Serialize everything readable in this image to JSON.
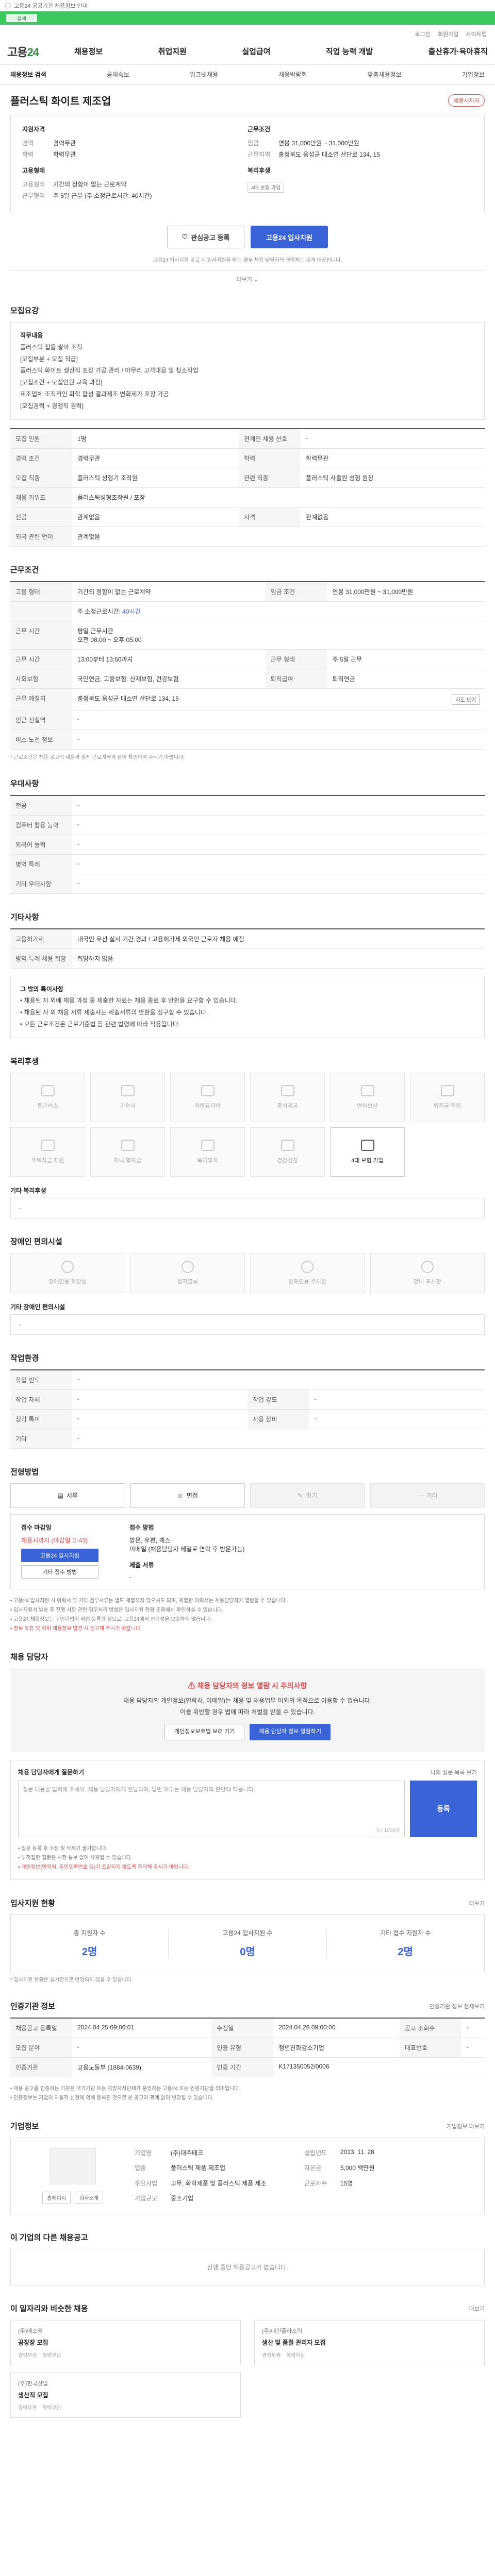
{
  "top": {
    "notice": "고용24 공공기관 채용정보 안내",
    "search_hint": "검색",
    "util": [
      "로그인",
      "회원가입",
      "사이트맵"
    ]
  },
  "nav": {
    "logo_a": "고용",
    "logo_b": "24",
    "menu": [
      "채용정보",
      "취업지원",
      "실업급여",
      "직업 능력 개발",
      "출산휴가·육아휴직"
    ],
    "sub": [
      "채용정보 검색",
      "공채속보",
      "워크넷채용",
      "채용박람회",
      "맞춤채용정보",
      "기업정보"
    ]
  },
  "job": {
    "title": "플러스틱 화이트 제조업",
    "badge": "채용시까지",
    "left_title": "지원자격",
    "left_rows": [
      [
        "경력",
        "경력무관"
      ],
      [
        "학력",
        "학력무관"
      ]
    ],
    "left_title2": "고용형태",
    "left_rows2": [
      [
        "고용형태",
        "기간의 정함이 없는 근로계약"
      ],
      [
        "근무형태",
        "주 5일 근무 (주 소정근로시간: 40시간)"
      ]
    ],
    "right_title": "근무조건",
    "right_rows": [
      [
        "임금",
        "연봉 31,000만원 ~ 31,000만원"
      ],
      [
        "근무지역",
        "충청북도 음성군 대소면 산단로 134, 15"
      ]
    ],
    "right_title2": "복리후생",
    "right_tag": "4대 보험 가입",
    "btn_interest": "관심공고 등록",
    "btn_apply": "고용24 입사지원",
    "notice": "고용24 입사지원 공고 시 입사지원을 받는 경우 채용 담당자의 연락처는 공개 대상입니다.",
    "fold": "더보기"
  },
  "recruit": {
    "title": "모집요강",
    "desc_head": "직무내용",
    "desc_lines": [
      "플러스틱 집을 쌓아 조직",
      "[모집부분 + 모집 직급]",
      "플러스틱 화이트 생산직 포장 가공 관리 / 마무리 고객대응 및 청소작업",
      "[모집조건 + 모집인원 교육 과정]",
      "제조업체 조직적인 화학 합성 결과제조 변화제가 포장 가공",
      "[모집경력 + 경쟁직 경력]"
    ],
    "rows": [
      [
        "모집 인원",
        "1명",
        "관계인 채용 선호",
        "-"
      ],
      [
        "경력 조건",
        "경력무관",
        "학력",
        "학력무관"
      ],
      [
        "모집 직종",
        "플러스틱 성형기 조작원",
        "관련 직종",
        "플러스틱 사출원 성형 원장"
      ],
      [
        "채용 키워드",
        "플러스틱성형조작원 / 포장",
        "",
        ""
      ],
      [
        "전공",
        "관계없음",
        "자격",
        "관계없음"
      ],
      [
        "외국 관련 언어",
        "관계없음",
        "",
        ""
      ]
    ]
  },
  "work": {
    "title": "근무조건",
    "rows": [
      [
        "고용 형태",
        "기간의 정함이 없는 근로계약",
        "임금 조건",
        "연봉 31,000만원 ~ 31,000만원"
      ],
      [
        "",
        "주 소정근로시간",
        "",
        "40시간"
      ],
      [
        "근무 시간",
        "평일 근무시간",
        "",
        "오전 08:00 ~ 오후 05:00"
      ],
      [
        "근무 시간",
        "13:00부터 13:50까지",
        "근무 형태",
        "주 5일 근무"
      ],
      [
        "사회보험",
        "국민연금, 고용보험, 산재보험, 건강보험",
        "퇴직급여",
        "퇴직연금"
      ],
      [
        "근무 예정지",
        "충청북도 음성군 대소면 산단로 134, 15",
        "",
        ""
      ],
      [
        "인근 전철역",
        "-",
        "",
        ""
      ],
      [
        "버스 노선 정보",
        "-",
        "",
        ""
      ]
    ],
    "map_btn": "지도 보기",
    "note": "* 근로조건은 채용 공고의 내용과 실제 근로계약과 같이 확인하여 주시기 바랍니다."
  },
  "prefer": {
    "title": "우대사항",
    "rows": [
      [
        "전공",
        "-"
      ],
      [
        "컴퓨터 활용 능력",
        "-"
      ],
      [
        "외국어 능력",
        "-"
      ],
      [
        "병역 특례",
        "-"
      ],
      [
        "기타 우대사항",
        "-"
      ]
    ]
  },
  "extra": {
    "title": "기타사항",
    "rows": [
      [
        "고용허가제",
        "내국인 우선 실시 기간 경과 / 고용허가제 외국인 근로자 채용 예정"
      ],
      [
        "병역 특례 채용 희망",
        "희망하지 않음"
      ]
    ],
    "box_head": "그 밖의 특이사항",
    "box_lines": [
      "• 채용된 자 외에 채용 과정 중 제출한 자료는 채용 종료 후 반환을 요구할 수 있습니다.",
      "• 채용된 자 외 채용 서류 제출자는 제출서류의 반환을 청구할 수 있습니다.",
      "• 모든 근로조건은 근로기준법 등 관련 법령에 따라 적용됩니다."
    ]
  },
  "welfare": {
    "title": "복리후생",
    "items": [
      [
        "통근버스",
        false
      ],
      [
        "기숙사",
        false
      ],
      [
        "차량유지비",
        false
      ],
      [
        "중식제공",
        false
      ],
      [
        "연차보상",
        false
      ],
      [
        "퇴직금 적립",
        false
      ],
      [
        "주택자금 지원",
        false
      ],
      [
        "자녀 학자금",
        false
      ],
      [
        "육아휴직",
        false
      ],
      [
        "건강검진",
        false
      ],
      [
        "4대 보험 가입",
        true
      ]
    ],
    "other_title": "기타 복리후생",
    "other_value": "-"
  },
  "disabled": {
    "title": "장애인 편의시설",
    "items": [
      "장애인용 화장실",
      "점자블록",
      "장애인용 주차장",
      "안내 표시판"
    ],
    "other_title": "기타 장애인 편의시설",
    "other_value": "-"
  },
  "worktype": {
    "title": "작업환경",
    "rows": [
      [
        "작업 빈도",
        "-",
        "",
        ""
      ],
      [
        "작업 자세",
        "-",
        "작업 강도",
        "-"
      ],
      [
        "청각 특이",
        "-",
        "사용 장비",
        "-"
      ],
      [
        "기타",
        "-",
        "",
        ""
      ]
    ]
  },
  "process": {
    "title": "전형방법",
    "steps": [
      [
        "서류",
        false
      ],
      [
        "면접",
        false
      ],
      [
        "필기",
        true
      ],
      [
        "기타",
        true
      ]
    ],
    "col1_title": "접수 마감일",
    "col1_value": "채용시까지 (마감일 D-43)",
    "col1_btn": "고용24 입사지원",
    "col1_btn2": "기타 접수 방법",
    "col2_title": "접수 방법",
    "col2_value": "방문, 우편, 팩스",
    "col2_sub": "이메일 (채용담당자 메일로 연락 후 방문가능)",
    "col3_title": "제출 서류",
    "col3_value": "-",
    "bullets": [
      "• 고용24 입사지원 시 이력서 및 기타 첨부서류는 별도 제출하지 않으셔도 되며, 제출한 이력서는 채용담당자가 열람할 수 있습니다.",
      "• 입사지원서 발송 후 진행 사항 관련 업무처리 방법은 입사지원 현황 조회에서 확인하실 수 있습니다.",
      "• 고용24 채용정보는 구인기업이 직접 등록한 정보로, 고용24에서 신뢰성을 보증하지 않습니다."
    ],
    "bullet_red": "• 정보 오류 및 허위 채용정보 발견 시 신고해 주시기 바랍니다."
  },
  "contact": {
    "title": "채용 담당자",
    "warn_title": "채용 담당자의 정보 열람 시 주의사항",
    "warn_lines": [
      "채용 담당자의 개인정보(연락처, 이메일)는 채용 및 채용업무 이외의 목적으로 이용할 수 없습니다.",
      "이를 위반할 경우 법에 따라 처벌을 받을 수 있습니다."
    ],
    "btn1": "개인정보보호법 보러 가기",
    "btn2": "채용 담당자 정보 열람하기",
    "ask_title": "채용 담당자에게 질문하기",
    "ask_side": "나의 질문 목록 보기",
    "ask_placeholder": "질문 내용을 입력해 주세요. 채용 담당자에게 전달되며, 답변 여부는 채용 담당자의 판단에 따릅니다.",
    "ask_count": "0 / 1000자",
    "ask_btn": "등록",
    "ask_notes": [
      "• 질문 등록 후 수정 및 삭제가 불가합니다.",
      "• 부적절한 질문은 사전 통보 없이 삭제될 수 있습니다."
    ],
    "ask_red": "• 개인정보(연락처, 주민등록번호 등)가 포함되지 않도록 주의해 주시기 바랍니다."
  },
  "stats": {
    "title": "입사지원 현황",
    "side": "더보기",
    "items": [
      [
        "총 지원자 수",
        "2명"
      ],
      [
        "고용24 입사지원 수",
        "0명"
      ],
      [
        "기타 접수 지원자 수",
        "2명"
      ]
    ],
    "note": "* 입사지원 현황은 실시간으로 반영되지 않을 수 있습니다."
  },
  "auth": {
    "title": "인증기관 정보",
    "side": "인증기관 정보 전체보기",
    "rows": [
      [
        "채용공고 등록일",
        "2024.04.25 09:06:01",
        "수정일",
        "2024.04.26 09:00:00",
        "공고 조회수",
        "-"
      ],
      [
        "모집 분야",
        "-",
        "인증 유형",
        "청년친화강소기업",
        "대표번호",
        "-"
      ],
      [
        "인증기관",
        "고용노동부 (1884-0639)",
        "인증 기간",
        "K171350052/0006"
      ]
    ],
    "notes": [
      "• 채용 공고를 인증하는 기관은 국가기관 또는 지방자치단체가 운영하는 고용24 또는 인증기관을 의미합니다.",
      "• 인증정보는 기업의 자율적 신청에 의해 등록된 것으로 본 공고와 관계 없이 변경될 수 있습니다."
    ]
  },
  "company": {
    "title": "기업정보",
    "side": "기업정보 더보기",
    "links": [
      "홈페이지",
      "회사소개"
    ],
    "rows": [
      [
        "기업명",
        "(주)대주테크",
        "설립년도",
        "2013. 11. 28"
      ],
      [
        "업종",
        "플러스틱 제품 제조업",
        "자본금",
        "5,000 백만원"
      ],
      [
        "주요사업",
        "고무, 화학제품 및 플라스틱 제품 제조",
        "근로자수",
        "15명"
      ],
      [
        "기업규모",
        "중소기업",
        "",
        ""
      ]
    ]
  },
  "other_jobs": {
    "title": "이 기업의 다른 채용공고",
    "empty": "진행 중인 채용공고가 없습니다."
  },
  "recommend": {
    "title": "이 일자리와 비슷한 채용",
    "side": "더보기",
    "cards": [
      [
        "(주)에스엠",
        "공장장 모집",
        "경력무관",
        "학력무관"
      ],
      [
        "(주)대한플라스틱",
        "생산 및 품질 관리자 모집",
        "경력무관",
        "학력무관"
      ],
      [
        "(주)한국산업",
        "생산직 모집",
        "경력무관",
        "학력무관"
      ]
    ]
  }
}
